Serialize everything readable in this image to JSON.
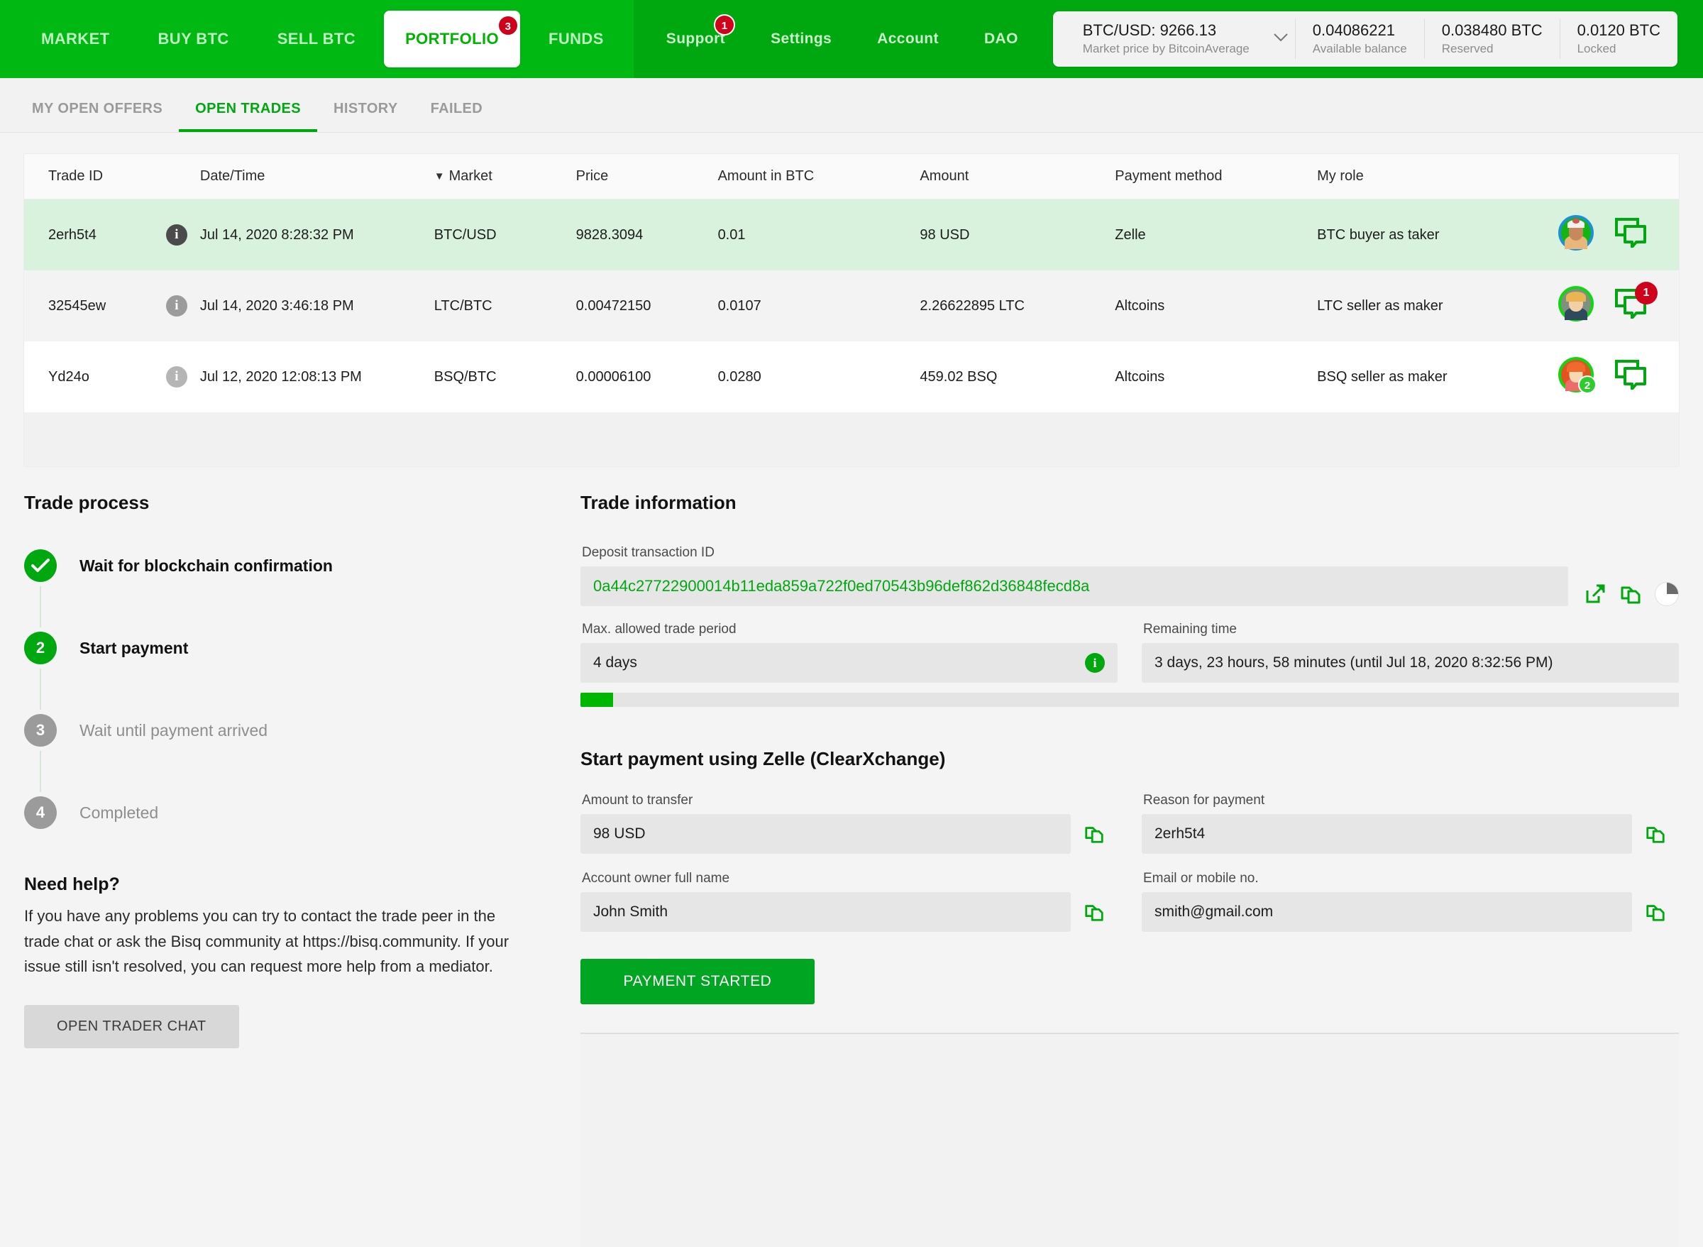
{
  "topnav": {
    "primary_items": [
      {
        "label": "MARKET",
        "active": false
      },
      {
        "label": "BUY BTC",
        "active": false
      },
      {
        "label": "SELL BTC",
        "active": false
      },
      {
        "label": "PORTFOLIO",
        "active": true,
        "badge": "3"
      },
      {
        "label": "FUNDS",
        "active": false
      }
    ],
    "secondary_items": [
      {
        "label": "Support",
        "badge": "1"
      },
      {
        "label": "Settings"
      },
      {
        "label": "Account"
      },
      {
        "label": "DAO"
      }
    ],
    "accent_color": "#00b300",
    "badge_color": "#d0021b"
  },
  "balance_panel": {
    "market_price_value": "BTC/USD: 9266.13",
    "market_price_label": "Market price by BitcoinAverage",
    "chevron": "chevron-down-icon",
    "cells": [
      {
        "value": "0.04086221",
        "label": "Available balance"
      },
      {
        "value": "0.038480 BTC",
        "label": "Reserved"
      },
      {
        "value": "0.0120 BTC",
        "label": "Locked"
      }
    ]
  },
  "subnav": {
    "items": [
      {
        "label": "MY OPEN OFFERS",
        "active": false
      },
      {
        "label": "OPEN TRADES",
        "active": true
      },
      {
        "label": "HISTORY",
        "active": false
      },
      {
        "label": "FAILED",
        "active": false
      }
    ]
  },
  "trades_table": {
    "sort_indicator": "▼",
    "sorted_column": "Market",
    "columns": [
      "Trade ID",
      "Date/Time",
      "Market",
      "Price",
      "Amount in BTC",
      "Amount",
      "Payment method",
      "My role"
    ],
    "rows": [
      {
        "trade_id": "2erh5t4",
        "date_time": "Jul 14, 2020 8:28:32 PM",
        "market": "BTC/USD",
        "price": "9828.3094",
        "amount_in_btc": "0.01",
        "amount": "98 USD",
        "payment_method": "Zelle",
        "my_role": "BTC buyer as taker",
        "chat_badge": "",
        "avatar_badge": "",
        "selected": true
      },
      {
        "trade_id": "32545ew",
        "date_time": "Jul 14, 2020 3:46:18 PM",
        "market": "LTC/BTC",
        "price": "0.00472150",
        "amount_in_btc": "0.0107",
        "amount": "2.26622895 LTC",
        "payment_method": "Altcoins",
        "my_role": "LTC seller as maker",
        "chat_badge": "1",
        "avatar_badge": "",
        "selected": false
      },
      {
        "trade_id": "Yd24o",
        "date_time": "Jul 12, 2020 12:08:13 PM",
        "market": "BSQ/BTC",
        "price": "0.00006100",
        "amount_in_btc": "0.0280",
        "amount": "459.02 BSQ",
        "payment_method": "Altcoins",
        "my_role": "BSQ seller as maker",
        "chat_badge": "",
        "avatar_badge": "2",
        "selected": false
      }
    ]
  },
  "trade_process": {
    "title": "Trade process",
    "steps": [
      {
        "marker": "✓",
        "label": "Wait for blockchain confirmation",
        "state": "done"
      },
      {
        "marker": "2",
        "label": "Start payment",
        "state": "current"
      },
      {
        "marker": "3",
        "label": "Wait until payment arrived",
        "state": "todo"
      },
      {
        "marker": "4",
        "label": "Completed",
        "state": "todo"
      }
    ]
  },
  "need_help": {
    "title": "Need help?",
    "body": "If you have any problems you can try to contact the trade peer in the trade chat or ask the Bisq community at https://bisq.community. If your issue still isn't resolved, you can request more help from a mediator.",
    "button_label": "OPEN TRADER CHAT"
  },
  "trade_information": {
    "title": "Trade information",
    "deposit_tx_label": "Deposit transaction ID",
    "deposit_tx_value": "0a44c27722900014b11eda859a722f0ed70543b96def862d36848fecd8a",
    "deposit_tx_actions": [
      "external-link-icon",
      "copy-icon",
      "pie-progress-icon"
    ],
    "max_period_label": "Max. allowed trade period",
    "max_period_value": "4 days",
    "max_period_info_icon": "info-icon",
    "remaining_time_label": "Remaining time",
    "remaining_time_value": "3 days, 23 hours, 58 minutes (until Jul 18, 2020 8:32:56 PM)",
    "progress_percent": 3
  },
  "payment": {
    "title": "Start payment using Zelle (ClearXchange)",
    "fields": [
      {
        "label": "Amount to transfer",
        "value": "98 USD",
        "copy": true
      },
      {
        "label": "Reason for payment",
        "value": "2erh5t4",
        "copy": true
      },
      {
        "label": "Account owner full name",
        "value": "John Smith",
        "copy": true
      },
      {
        "label": "Email or mobile no.",
        "value": "smith@gmail.com",
        "copy": true
      }
    ],
    "submit_label": "PAYMENT STARTED"
  }
}
